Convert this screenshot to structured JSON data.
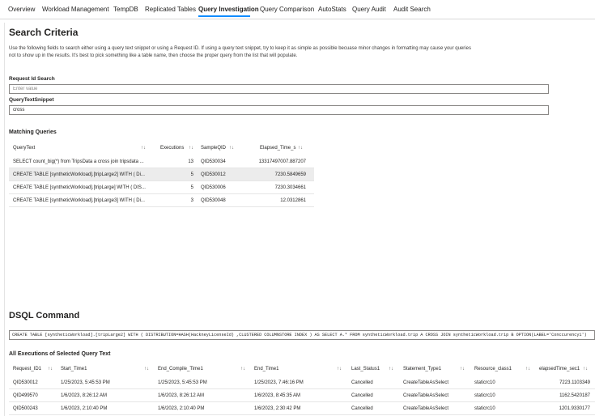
{
  "tabs": [
    {
      "label": "Overview"
    },
    {
      "label": "Workload Management"
    },
    {
      "label": "TempDB"
    },
    {
      "label": "Replicated Tables"
    },
    {
      "label": "Query Investigation",
      "active": true
    },
    {
      "label": "Query Comparison"
    },
    {
      "label": "AutoStats"
    },
    {
      "label": "Query Audit"
    },
    {
      "label": "Audit Search"
    }
  ],
  "search": {
    "title": "Search Criteria",
    "description": "Use the following fields to search either using a query text snippet or using a Request ID. If using a query text snippet, try to keep it as simple as possible becuase minor changes in formatting may cause your queries not to show up in the results. It's best to pick something like a table name, then choose the proper query from the list that will populate.",
    "request_id_label": "Request Id Search",
    "request_id_placeholder": "Enter value",
    "snippet_label": "QueryTextSnippet",
    "snippet_value": "cross"
  },
  "matching": {
    "title": "Matching Queries",
    "columns": [
      "QueryText",
      "Executions",
      "SampleQID",
      "Elapsed_Time_s"
    ],
    "rows": [
      {
        "query": "SELECT count_big(*) from TripsData a cross join tripsdata ...",
        "executions": "13",
        "qid": "QID530034",
        "elapsed": "13317497007.887207"
      },
      {
        "query": "CREATE TABLE [syntheticWorkload].[tripLarge2] WITH ( Di...",
        "executions": "5",
        "qid": "QID530012",
        "elapsed": "7230.5849659"
      },
      {
        "query": "CREATE TABLE [syntheticWorkload].[tripLarge] WITH ( DIS...",
        "executions": "5",
        "qid": "QID530006",
        "elapsed": "7230.3034661"
      },
      {
        "query": "CREATE TABLE [syntheticWorkload].[tripLarge3] WITH ( Di...",
        "executions": "3",
        "qid": "QID530048",
        "elapsed": "12.0312861"
      }
    ]
  },
  "dsql": {
    "title": "DSQL Command",
    "command": "CREATE TABLE [syntheticWorkload].[tripLarge2] WITH ( DISTRIBUTION=HASH(HackneyLicenseId) ,CLUSTERED COLUMNSTORE INDEX ) AS SELECT A.* FROM syntheticWorkload.trip A CROSS JOIN syntheticWorkload.trip B OPTION(LABEL='Conccurency1')"
  },
  "executions": {
    "title": "All Executions of Selected Query Text",
    "columns": [
      "Request_ID1",
      "Start_Time1",
      "End_Compile_Time1",
      "End_Time1",
      "Last_Status1",
      "Statement_Type1",
      "Resource_class1",
      "elapsedTime_sec1"
    ],
    "rows": [
      {
        "rid": "QID530012",
        "start": "1/25/2023, 5:45:53 PM",
        "compile": "1/25/2023, 5:45:53 PM",
        "end": "1/25/2023, 7:46:16 PM",
        "status": "Cancelled",
        "type": "CreateTableAsSelect",
        "rclass": "staticrc10",
        "elapsed": "7223.1103349"
      },
      {
        "rid": "QID499570",
        "start": "1/6/2023, 8:26:12 AM",
        "compile": "1/6/2023, 8:26:12 AM",
        "end": "1/6/2023, 8:45:35 AM",
        "status": "Cancelled",
        "type": "CreateTableAsSelect",
        "rclass": "staticrc10",
        "elapsed": "1162.5420187"
      },
      {
        "rid": "QID500243",
        "start": "1/6/2023, 2:10:40 PM",
        "compile": "1/6/2023, 2:10:40 PM",
        "end": "1/6/2023, 2:30:42 PM",
        "status": "Cancelled",
        "type": "CreateTableAsSelect",
        "rclass": "staticrc10",
        "elapsed": "1201.9330177"
      }
    ]
  },
  "icons": {
    "sort": "sort-arrows-icon"
  },
  "colors": {
    "accent": "#118dff",
    "selected_row": "#ececec"
  }
}
